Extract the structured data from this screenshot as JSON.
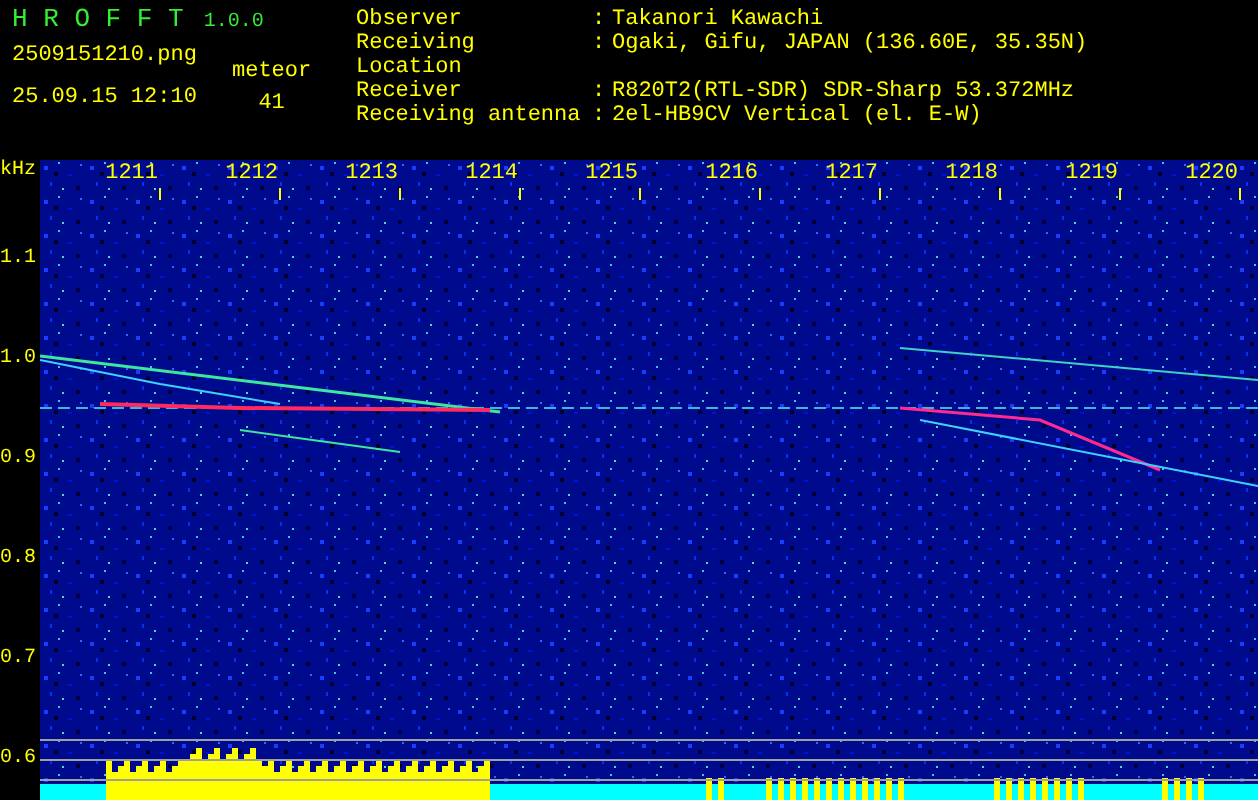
{
  "app": {
    "name": "H R O F F T",
    "version": "1.0.0",
    "file": "2509151210.png",
    "timestamp": "25.09.15 12:10",
    "counter_label": "meteor",
    "counter_value": "41"
  },
  "station_info": [
    {
      "label": "Observer",
      "separator": ":",
      "value": "Takanori Kawachi"
    },
    {
      "label": "Receiving Location",
      "separator": ":",
      "value": "Ogaki, Gifu, JAPAN (136.60E, 35.35N)"
    },
    {
      "label": "Receiver",
      "separator": ":",
      "value": "R820T2(RTL-SDR) SDR-Sharp 53.372MHz"
    },
    {
      "label": "Receiving antenna",
      "separator": ":",
      "value": "2el-HB9CV Vertical (el. E-W)"
    }
  ],
  "spectrogram": {
    "y_unit": "kHz",
    "x_labels": [
      "1211",
      "1212",
      "1213",
      "1214",
      "1215",
      "1216",
      "1217",
      "1218",
      "1219",
      "1220"
    ],
    "y_labels": [
      "1.1",
      "1.0",
      "0.9",
      "0.8",
      "0.7",
      "0.6"
    ]
  }
}
